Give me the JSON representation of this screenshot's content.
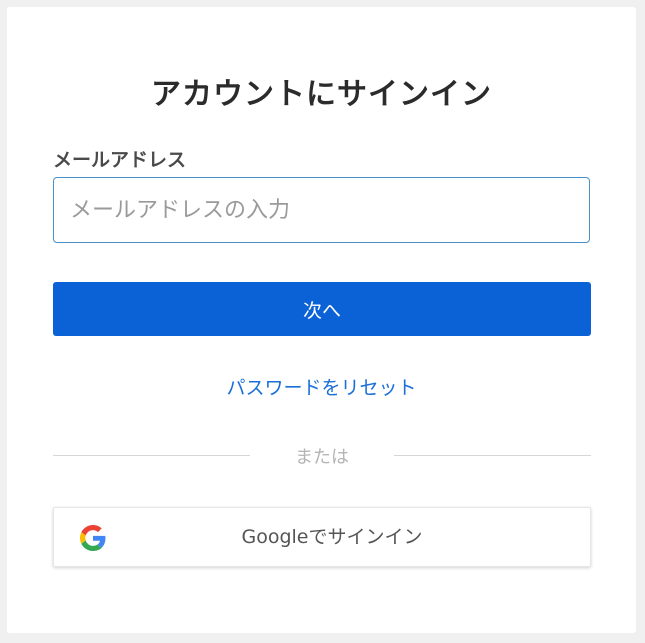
{
  "card": {
    "title": "アカウントにサインイン",
    "email": {
      "label": "メールアドレス",
      "placeholder": "メールアドレスの入力",
      "value": ""
    },
    "next_button_label": "次へ",
    "reset_link_label": "パスワードをリセット",
    "divider_text": "または",
    "google_button": {
      "label": "Googleでサインイン",
      "icon": "google-logo-icon"
    }
  },
  "colors": {
    "background": "#f0f0f0",
    "card": "#ffffff",
    "primary_button": "#0b62d6",
    "link": "#1a6fd8",
    "input_border": "#4a90c8",
    "divider": "#d6d6d6"
  }
}
